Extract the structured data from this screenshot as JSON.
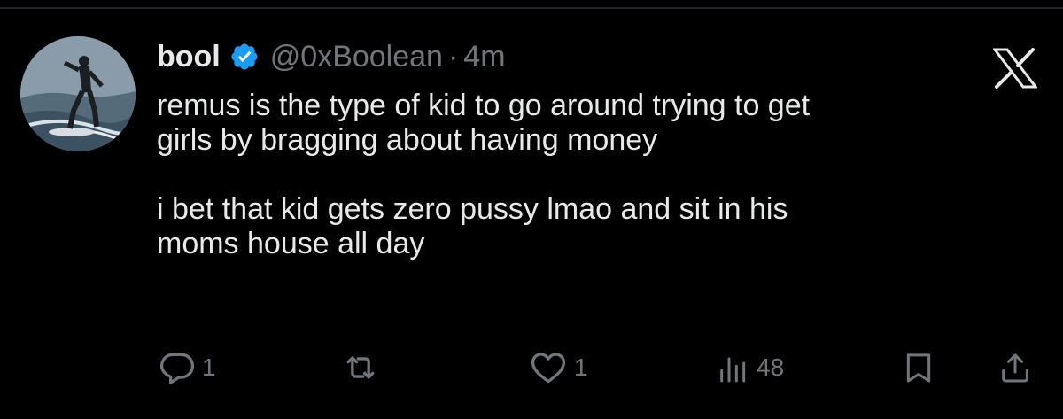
{
  "tweet": {
    "display_name": "bool",
    "handle": "@0xBoolean",
    "separator": "·",
    "time": "4m",
    "text": "remus is the type of kid to go around trying to get\ngirls by bragging about having money\n\ni bet that kid gets zero pussy lmao and sit in his\nmoms house all day",
    "verified": true,
    "icons": {
      "avatar": "avatar",
      "verified": "verified-badge-icon",
      "brand": "x-logo-icon"
    }
  },
  "actions": {
    "reply": {
      "icon": "reply-icon",
      "count": "1"
    },
    "retweet": {
      "icon": "retweet-icon"
    },
    "like": {
      "icon": "heart-icon",
      "count": "1"
    },
    "views": {
      "icon": "views-icon",
      "count": "48"
    },
    "bookmark": {
      "icon": "bookmark-icon"
    },
    "share": {
      "icon": "share-icon"
    }
  },
  "colors": {
    "background": "#000000",
    "text": "#e7e9ea",
    "muted": "#71767b",
    "verified": "#1d9bf0"
  }
}
